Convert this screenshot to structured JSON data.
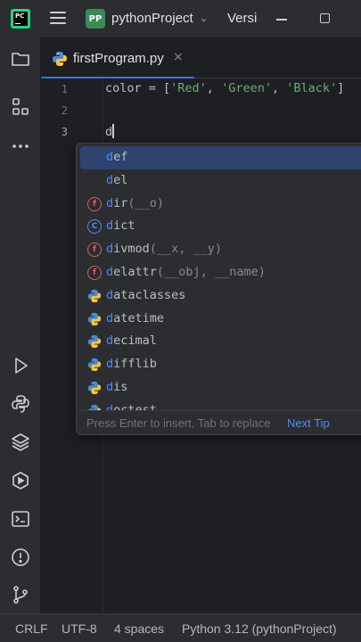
{
  "titlebar": {
    "project_badge": "PP",
    "project_name": "pythonProject",
    "vcs_label": "Versi"
  },
  "tab": {
    "label": "firstProgram.py",
    "close": "×"
  },
  "editor": {
    "line_numbers": [
      "1",
      "2",
      "3"
    ],
    "line1": {
      "prefix": "color = [",
      "s1": "'Red'",
      "sep1": ", ",
      "s2": "'Green'",
      "sep2": ", ",
      "s3": "'Black'",
      "suffix": "]"
    },
    "line3": "d"
  },
  "completion": {
    "items": [
      {
        "match": "d",
        "rest": "ef",
        "sig": "",
        "kind": "keyword"
      },
      {
        "match": "d",
        "rest": "el",
        "sig": "",
        "kind": "keyword"
      },
      {
        "match": "d",
        "rest": "ir",
        "sig": "(__o)",
        "kind": "function"
      },
      {
        "match": "d",
        "rest": "ict",
        "sig": "",
        "kind": "class"
      },
      {
        "match": "d",
        "rest": "ivmod",
        "sig": "(__x, __y)",
        "kind": "function"
      },
      {
        "match": "d",
        "rest": "elattr",
        "sig": "(__obj, __name)",
        "kind": "function"
      },
      {
        "match": "d",
        "rest": "ataclasses",
        "sig": "",
        "kind": "module"
      },
      {
        "match": "d",
        "rest": "atetime",
        "sig": "",
        "kind": "module"
      },
      {
        "match": "d",
        "rest": "ecimal",
        "sig": "",
        "kind": "module"
      },
      {
        "match": "d",
        "rest": "ifflib",
        "sig": "",
        "kind": "module"
      },
      {
        "match": "d",
        "rest": "is",
        "sig": "",
        "kind": "module"
      },
      {
        "match": "d",
        "rest": "octest",
        "sig": "",
        "kind": "module"
      }
    ],
    "hint": "Press Enter to insert, Tab to replace",
    "next_tip": "Next Tip"
  },
  "statusbar": {
    "line_separator": "CRLF",
    "encoding": "UTF-8",
    "indent": "4 spaces",
    "interpreter": "Python 3.12 (pythonProject)"
  },
  "colors": {
    "accent": "#3574f0",
    "string": "#6aab73",
    "match": "#548af7",
    "function_icon": "#db5c5c"
  }
}
